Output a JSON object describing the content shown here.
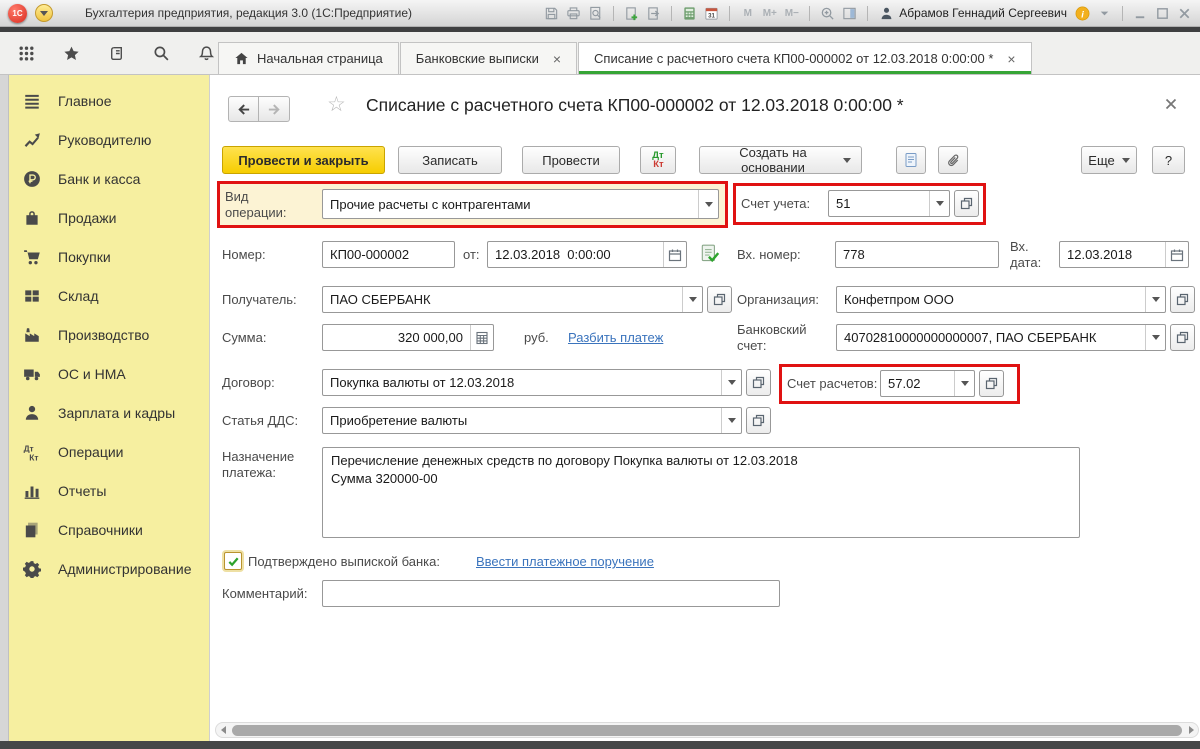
{
  "colors": {
    "accent_green": "#36a536",
    "highlight_red": "#e01212",
    "sidebar_bg": "#f6efa0",
    "primary_button_yellow": "#f6cd00",
    "link_blue": "#3b74bd"
  },
  "titlebar": {
    "app_title": "Бухгалтерия предприятия, редакция 3.0 (1С:Предприятие)",
    "user_name": "Абрамов Геннадий Сергеевич",
    "tool_icons": [
      "save-icon",
      "print-icon",
      "print-preview-icon",
      "sep",
      "doc-add-icon",
      "doc-send-icon",
      "sep",
      "calculator-icon",
      "calendar-icon",
      "sep",
      "m-icon",
      "m-plus-icon",
      "m-minus-icon",
      "sep",
      "zoom-in-icon",
      "split-view-icon",
      "sep"
    ],
    "right_icons": [
      "info-icon",
      "chevron-down-icon",
      "sep",
      "minimize-icon",
      "maximize-icon",
      "close-icon"
    ]
  },
  "tabbar": {
    "tool_icons": [
      "grid-menu-icon",
      "favorites-star-icon",
      "history-icon",
      "search-icon",
      "notifications-bell-icon"
    ],
    "tabs": [
      {
        "label": "Начальная страница"
      },
      {
        "label": "Банковские выписки"
      },
      {
        "label": "Списание с расчетного счета КП00-000002 от 12.03.2018 0:00:00 *"
      }
    ]
  },
  "sidebar": {
    "items": [
      {
        "key": "main",
        "label": "Главное",
        "icon": "menu-lines-icon"
      },
      {
        "key": "manager",
        "label": "Руководителю",
        "icon": "trend-icon"
      },
      {
        "key": "bank-cash",
        "label": "Банк и касса",
        "icon": "ruble-circle-icon"
      },
      {
        "key": "sales",
        "label": "Продажи",
        "icon": "bag-icon"
      },
      {
        "key": "purchases",
        "label": "Покупки",
        "icon": "cart-icon"
      },
      {
        "key": "warehouse",
        "label": "Склад",
        "icon": "pallet-icon"
      },
      {
        "key": "production",
        "label": "Производство",
        "icon": "factory-icon"
      },
      {
        "key": "fixed-assets",
        "label": "ОС и НМА",
        "icon": "truck-icon"
      },
      {
        "key": "payroll",
        "label": "Зарплата и кадры",
        "icon": "person-icon"
      },
      {
        "key": "operations",
        "label": "Операции",
        "icon": "dtkt-icon"
      },
      {
        "key": "reports",
        "label": "Отчеты",
        "icon": "barchart-icon"
      },
      {
        "key": "directories",
        "label": "Справочники",
        "icon": "books-icon"
      },
      {
        "key": "administration",
        "label": "Администрирование",
        "icon": "gear-icon"
      }
    ]
  },
  "form": {
    "title": "Списание с расчетного счета КП00-000002 от 12.03.2018 0:00:00 *",
    "toolbar": {
      "post_close": "Провести и закрыть",
      "save": "Записать",
      "post": "Провести",
      "dtkt": {
        "dt": "Дт",
        "kt": "Кт"
      },
      "create_based_on": "Создать на основании",
      "more": "Еще",
      "help": "?"
    },
    "fields": {
      "operation_type": {
        "label": "Вид операции:",
        "value": "Прочие расчеты с контрагентами"
      },
      "account": {
        "label": "Счет учета:",
        "value": "51"
      },
      "number": {
        "label": "Номер:",
        "value": "КП00-000002"
      },
      "date": {
        "label": "от:",
        "value": "12.03.2018  0:00:00"
      },
      "incoming_number": {
        "label": "Вх. номер:",
        "value": "778"
      },
      "incoming_date": {
        "label": "Вх. дата:",
        "value": "12.03.2018"
      },
      "payee": {
        "label": "Получатель:",
        "value": "ПАО СБЕРБАНК"
      },
      "organization": {
        "label": "Организация:",
        "value": "Конфетпром ООО"
      },
      "amount": {
        "label": "Сумма:",
        "value": "320 000,00",
        "currency": "руб.",
        "split_link": "Разбить платеж"
      },
      "bank_account": {
        "label": "Банковский счет:",
        "value": "40702810000000000007, ПАО СБЕРБАНК"
      },
      "contract": {
        "label": "Договор:",
        "value": "Покупка валюты от 12.03.2018"
      },
      "settlement_account": {
        "label": "Счет расчетов:",
        "value": "57.02"
      },
      "cash_flow_item": {
        "label": "Статья ДДС:",
        "value": "Приобретение валюты"
      },
      "payment_purpose": {
        "label": "Назначение платежа:",
        "value": "Перечисление денежных средств по договору Покупка валюты от 12.03.2018\nСумма 320000-00"
      },
      "confirmed": {
        "label": "Подтверждено выпиской банка:",
        "link": "Ввести платежное поручение",
        "checked": true
      },
      "comment": {
        "label": "Комментарий:",
        "value": ""
      }
    }
  }
}
